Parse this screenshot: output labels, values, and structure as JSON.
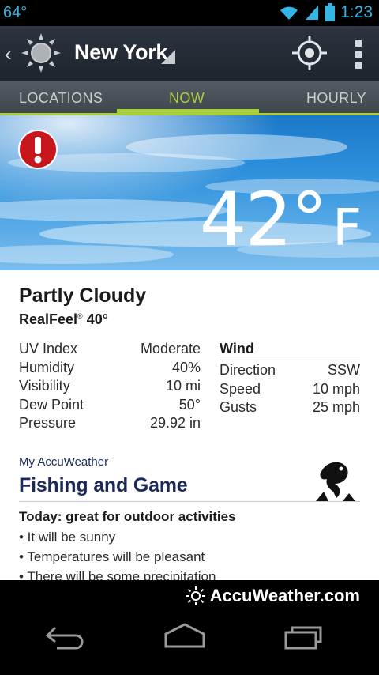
{
  "status_bar": {
    "temperature": "64°",
    "time": "1:23"
  },
  "header": {
    "city": "New York"
  },
  "tabs": [
    {
      "label": "LOCATIONS"
    },
    {
      "label": "NOW"
    },
    {
      "label": "HOURLY"
    }
  ],
  "hero": {
    "temperature": "42°",
    "unit": "F"
  },
  "current": {
    "condition": "Partly Cloudy",
    "realfeel_label": "RealFeel",
    "realfeel_mark": "®",
    "realfeel_value": "40°"
  },
  "details": [
    {
      "label": "UV Index",
      "value": "Moderate"
    },
    {
      "label": "Humidity",
      "value": "40%"
    },
    {
      "label": "Visibility",
      "value": "10 mi"
    },
    {
      "label": "Dew Point",
      "value": "50°"
    },
    {
      "label": "Pressure",
      "value": "29.92 in"
    }
  ],
  "wind": {
    "title": "Wind",
    "rows": [
      {
        "label": "Direction",
        "value": "SSW"
      },
      {
        "label": "Speed",
        "value": "10 mph"
      },
      {
        "label": "Gusts",
        "value": "25 mph"
      }
    ]
  },
  "my_accuweather": {
    "section_label": "My AccuWeather",
    "title": "Fishing and Game",
    "today": "Today: great for outdoor activities",
    "bullets": [
      "• It will be sunny",
      "• Temperatures will be pleasant",
      "• There will be some precipitation"
    ]
  },
  "footer": {
    "brand": "AccuWeather.com"
  },
  "colors": {
    "accent": "#a7cf3d",
    "status": "#33b5e5",
    "navy": "#1b2a5a"
  }
}
